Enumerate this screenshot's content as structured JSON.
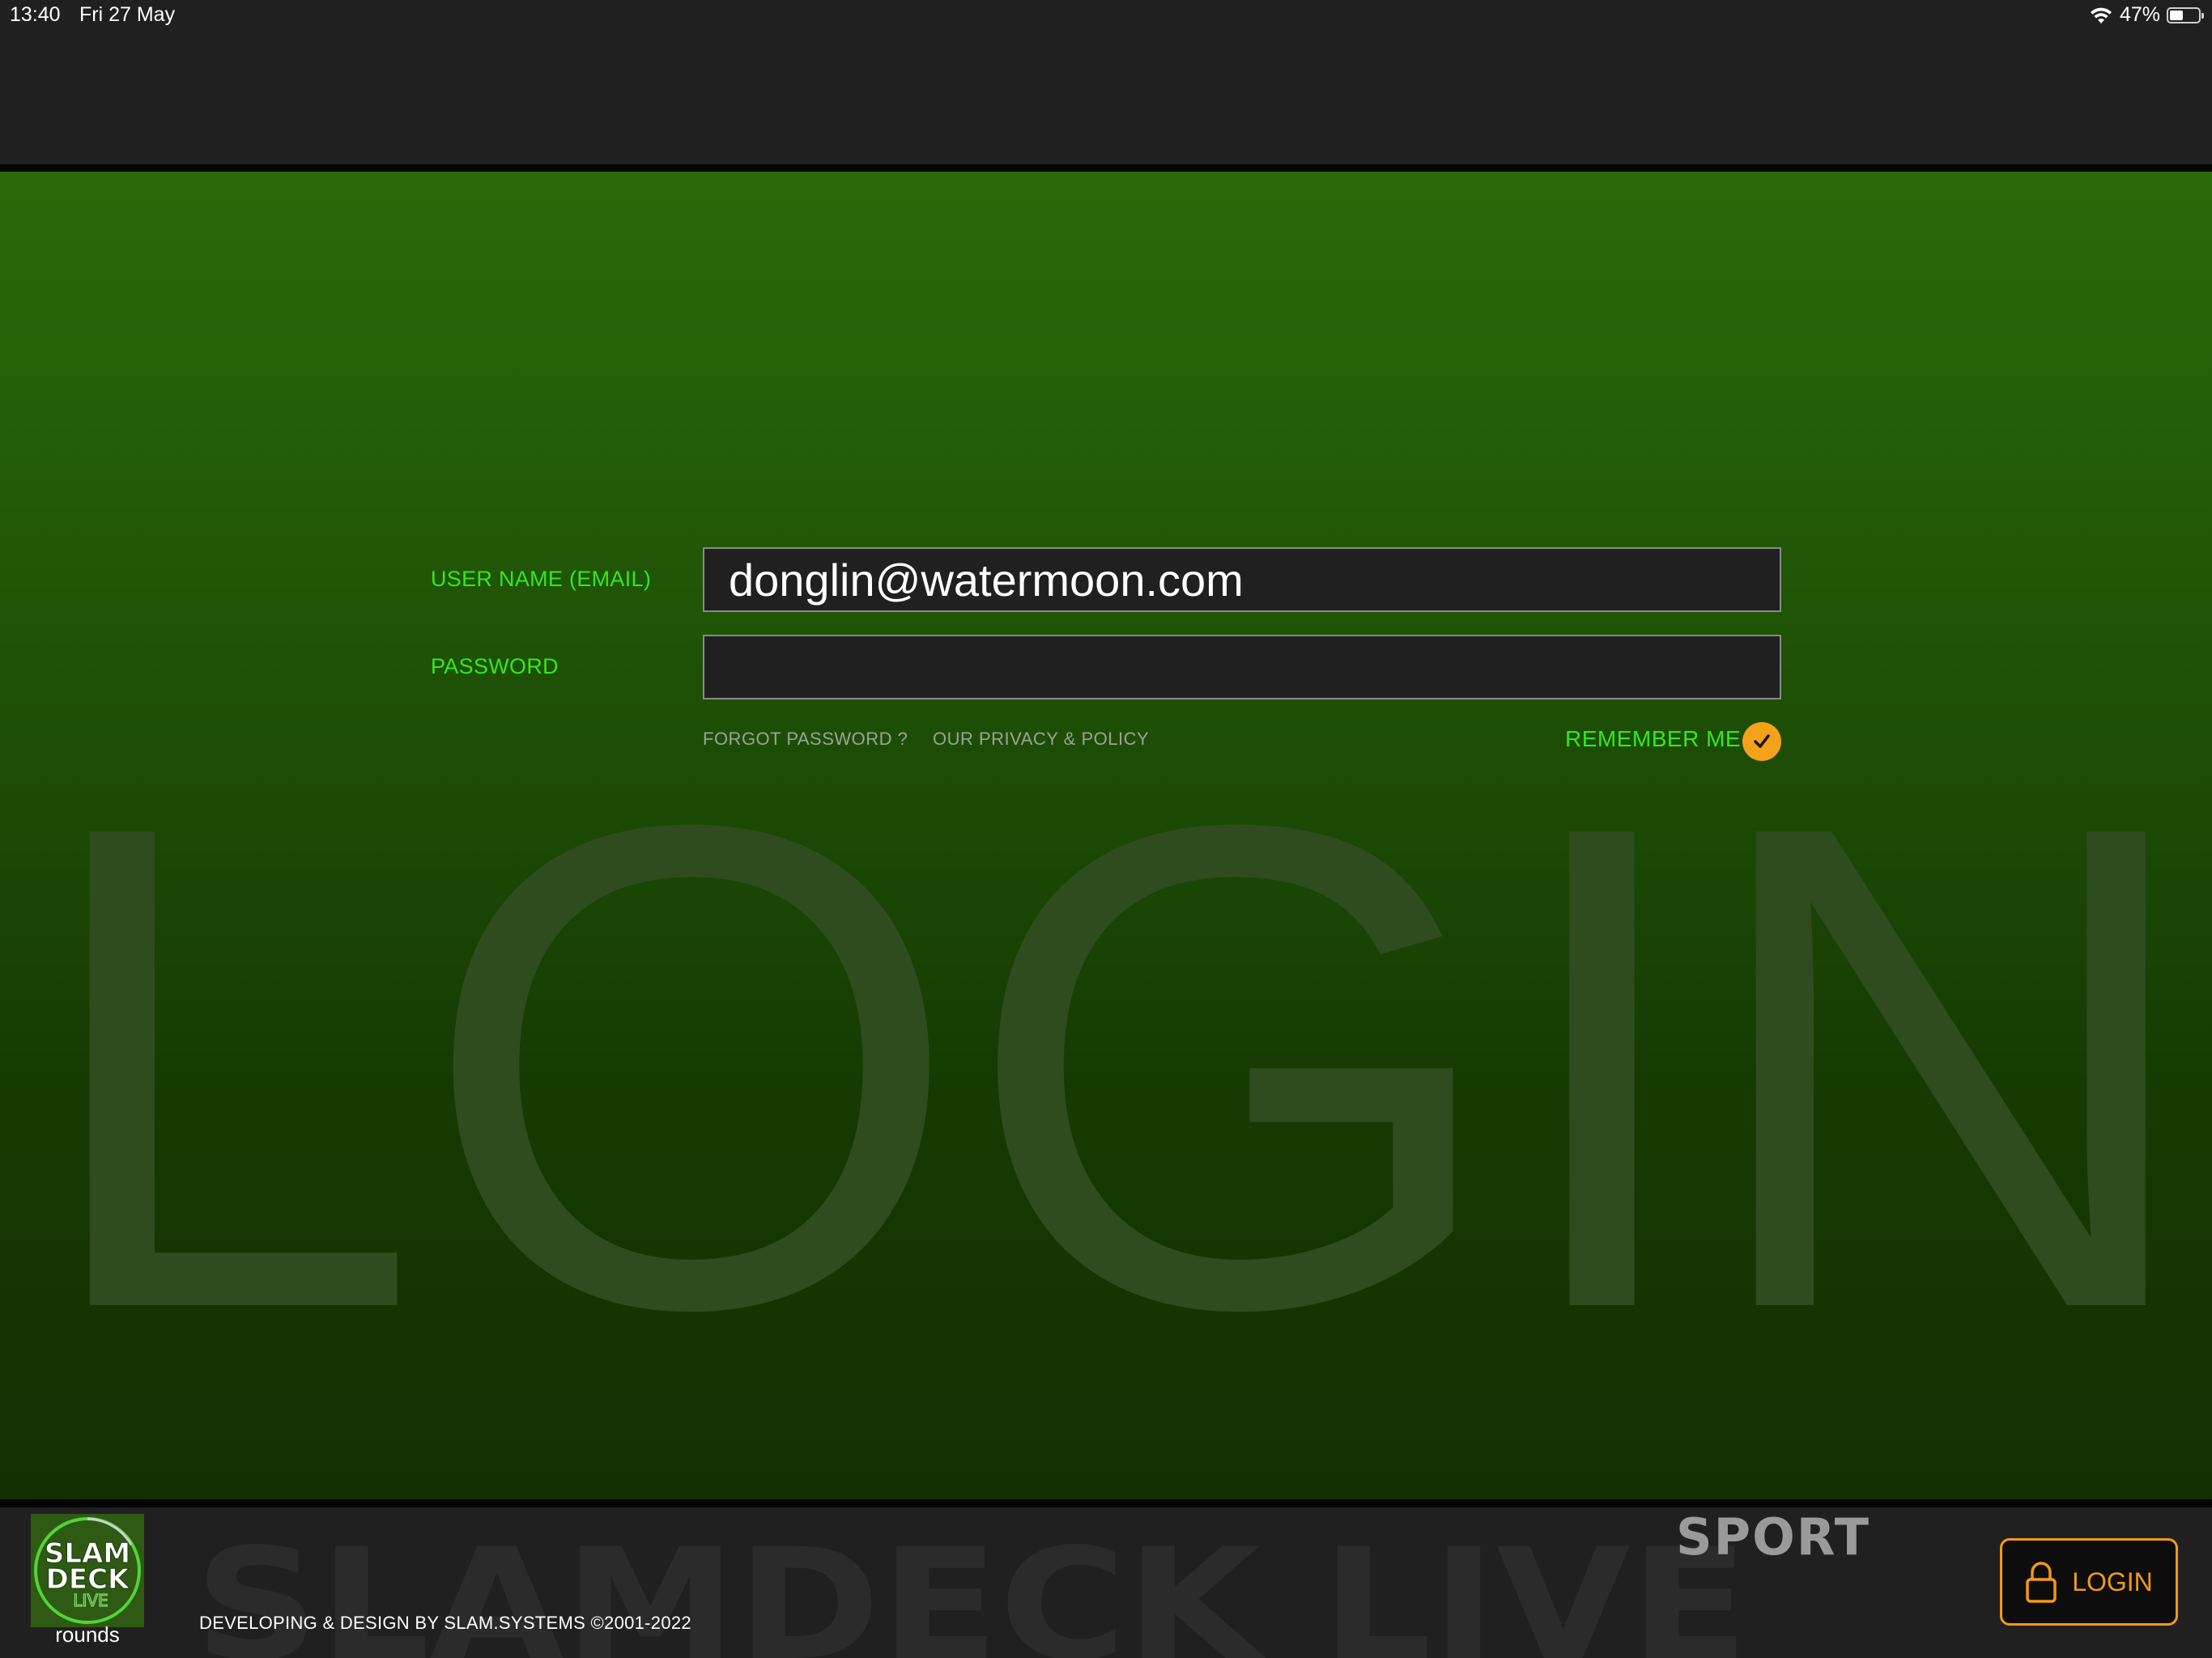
{
  "status_bar": {
    "time": "13:40",
    "date": "Fri 27 May",
    "battery": "47%",
    "battery_level": 0.47
  },
  "background": {
    "word": "LOGIN",
    "footer_word": "SLAMDECK LIVE",
    "sport": "SPORT"
  },
  "form": {
    "username_label": "USER NAME (EMAIL)",
    "username_value": "donglin@watermoon.com",
    "password_label": "PASSWORD",
    "password_value": "",
    "forgot_password": "FORGOT PASSWORD ?",
    "privacy_policy": "OUR PRIVACY & POLICY",
    "remember_me": "REMEMBER ME",
    "remember_checked": true
  },
  "footer": {
    "logo_text": [
      "SLAM",
      "DECK",
      "LIVE"
    ],
    "logo_label": "rounds",
    "copyright": "DEVELOPING & DESIGN BY SLAM.SYSTEMS ©2001-2022",
    "login_button": "LOGIN"
  },
  "colors": {
    "accent_green": "#34e81c",
    "accent_orange": "#f39a14",
    "panel_green_top": "#2a6a0a",
    "panel_green_bottom": "#133003",
    "bar_dark": "#202020"
  }
}
